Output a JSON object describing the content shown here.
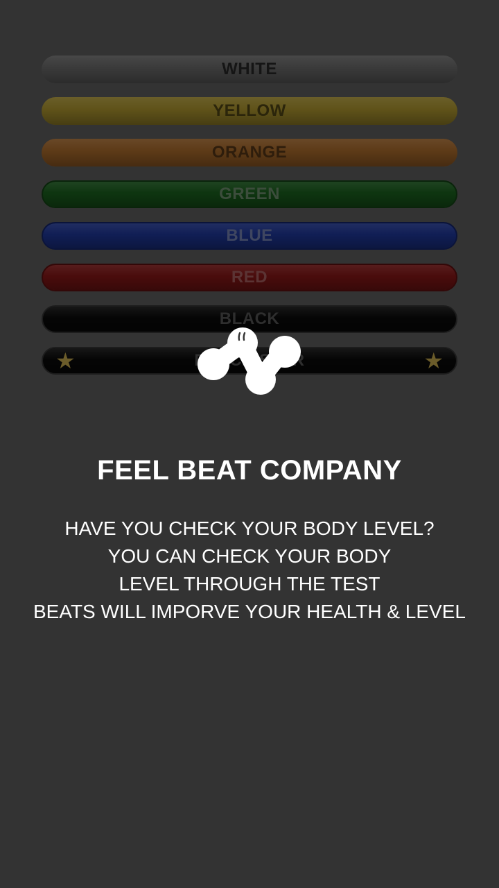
{
  "levels": [
    {
      "label": "WHITE",
      "color": "#3a3a3a"
    },
    {
      "label": "YELLOW",
      "color": "#5f5219"
    },
    {
      "label": "ORANGE",
      "color": "#5d3a17"
    },
    {
      "label": "GREEN",
      "color": "#0e3510"
    },
    {
      "label": "BLUE",
      "color": "#101e55"
    },
    {
      "label": "RED",
      "color": "#4a0c0c"
    },
    {
      "label": "BLACK",
      "color": "#050505"
    },
    {
      "label": "BLACK STAR",
      "color": "#050505",
      "star": "★"
    }
  ],
  "logo_icon": "feel-beat-logo-icon",
  "company_name": "FEEL BEAT COMPANY",
  "description": [
    "HAVE YOU CHECK YOUR BODY LEVEL?",
    "YOU CAN CHECK YOUR BODY",
    "LEVEL THROUGH THE TEST",
    "BEATS WILL IMPORVE YOUR HEALTH & LEVEL"
  ],
  "colors": {
    "background": "#333333",
    "text": "#ffffff",
    "star": "#6b5c2a"
  }
}
